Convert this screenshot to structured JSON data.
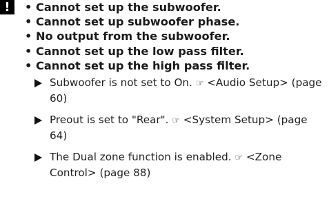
{
  "warning_icon_glyph": "!",
  "symptoms": [
    "• Cannot set up the subwoofer.",
    "• Cannot set up subwoofer phase.",
    "• No output from the subwoofer.",
    "• Cannot set up the low pass filter.",
    "• Cannot set up the high pass filter."
  ],
  "causes": [
    {
      "text": "Subwoofer is not set to On.",
      "ref_icon": "☞",
      "ref_text": "<Audio Setup> (page 60)"
    },
    {
      "text": "Preout is set to \"Rear\".",
      "ref_icon": "☞",
      "ref_text": "<System Setup> (page 64)"
    },
    {
      "text": "The Dual zone function is enabled.",
      "ref_icon": "☞",
      "ref_text": "<Zone Control> (page 88)"
    }
  ]
}
